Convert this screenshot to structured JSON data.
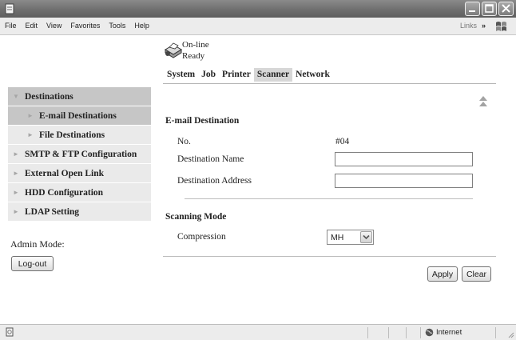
{
  "window": {
    "menu": [
      "File",
      "Edit",
      "View",
      "Favorites",
      "Tools",
      "Help"
    ],
    "links_label": "Links",
    "links_more": "»"
  },
  "status": {
    "line1": "On-line",
    "line2": "Ready"
  },
  "tabs": [
    "System",
    "Job",
    "Printer",
    "Scanner",
    "Network"
  ],
  "active_tab": "Scanner",
  "nav": [
    {
      "label": "Destinations"
    },
    {
      "label": "E-mail Destinations"
    },
    {
      "label": "File Destinations"
    },
    {
      "label": "SMTP & FTP Configuration"
    },
    {
      "label": "External Open Link"
    },
    {
      "label": "HDD Configuration"
    },
    {
      "label": "LDAP Setting"
    }
  ],
  "admin": {
    "label": "Admin Mode:",
    "logout": "Log-out"
  },
  "form": {
    "email_section": "E-mail Destination",
    "no_label": "No.",
    "no_value": "#04",
    "dest_name_label": "Destination Name",
    "dest_name_value": "",
    "dest_addr_label": "Destination Address",
    "dest_addr_value": "",
    "scan_section": "Scanning Mode",
    "compression_label": "Compression",
    "compression_value": "MH"
  },
  "buttons": {
    "apply": "Apply",
    "clear": "Clear"
  },
  "statusbar": {
    "zone": "Internet"
  }
}
